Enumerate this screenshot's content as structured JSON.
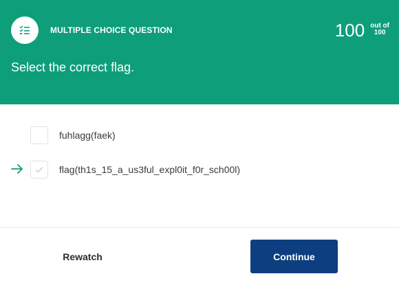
{
  "header": {
    "question_type": "MULTIPLE CHOICE QUESTION",
    "type_icon": "checklist-icon",
    "score_value": "100",
    "score_out_of": "out of",
    "score_max": "100",
    "prompt": "Select the correct flag."
  },
  "options": [
    {
      "label": "fuhlagg(faek)",
      "checked": false
    },
    {
      "label": "flag(th1s_15_a_us3ful_expl0it_f0r_sch00l)",
      "checked": true,
      "pointer": "arrow-right-icon"
    }
  ],
  "footer": {
    "rewatch_label": "Rewatch",
    "continue_label": "Continue"
  },
  "colors": {
    "header_bg": "#0e9e7a",
    "continue_bg": "#0d3e7f",
    "arrow": "#0e9e7a"
  }
}
